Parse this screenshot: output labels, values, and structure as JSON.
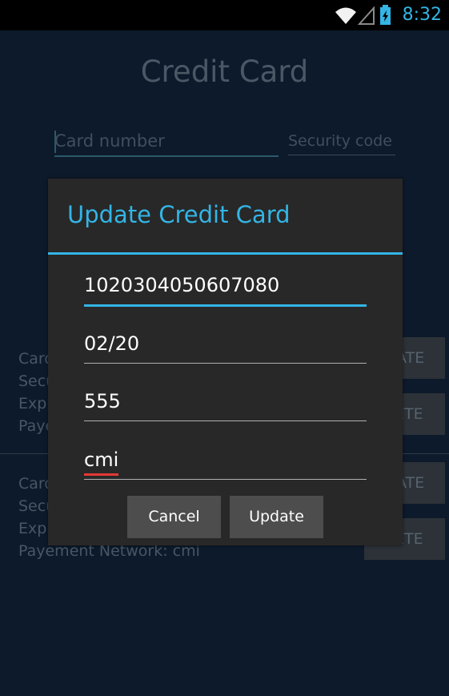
{
  "status_bar": {
    "time": "8:32",
    "icons": [
      "wifi-icon",
      "signal-icon",
      "battery-charging-icon"
    ],
    "accent_color": "#33b5e5"
  },
  "app": {
    "title": "Credit Card",
    "card_number_placeholder": "Card number",
    "security_code_placeholder": "Security code",
    "cards": [
      {
        "lines": [
          "Card",
          "Secu",
          "Expi",
          "Paye"
        ],
        "update_label": "DATE",
        "delete_label": "LETE"
      },
      {
        "lines": [
          "Card",
          "Secu",
          "Expi",
          "Payement Network: cmi"
        ],
        "update_label": "DATE",
        "delete_label": "LETE"
      }
    ]
  },
  "dialog": {
    "title": "Update Credit Card",
    "fields": [
      {
        "value": "1020304050607080",
        "focused": true
      },
      {
        "value": "02/20",
        "focused": false
      },
      {
        "value": "555",
        "focused": false
      },
      {
        "value": "cmi",
        "focused": false,
        "spellcheck": true
      }
    ],
    "cancel_label": "Cancel",
    "update_label": "Update"
  }
}
